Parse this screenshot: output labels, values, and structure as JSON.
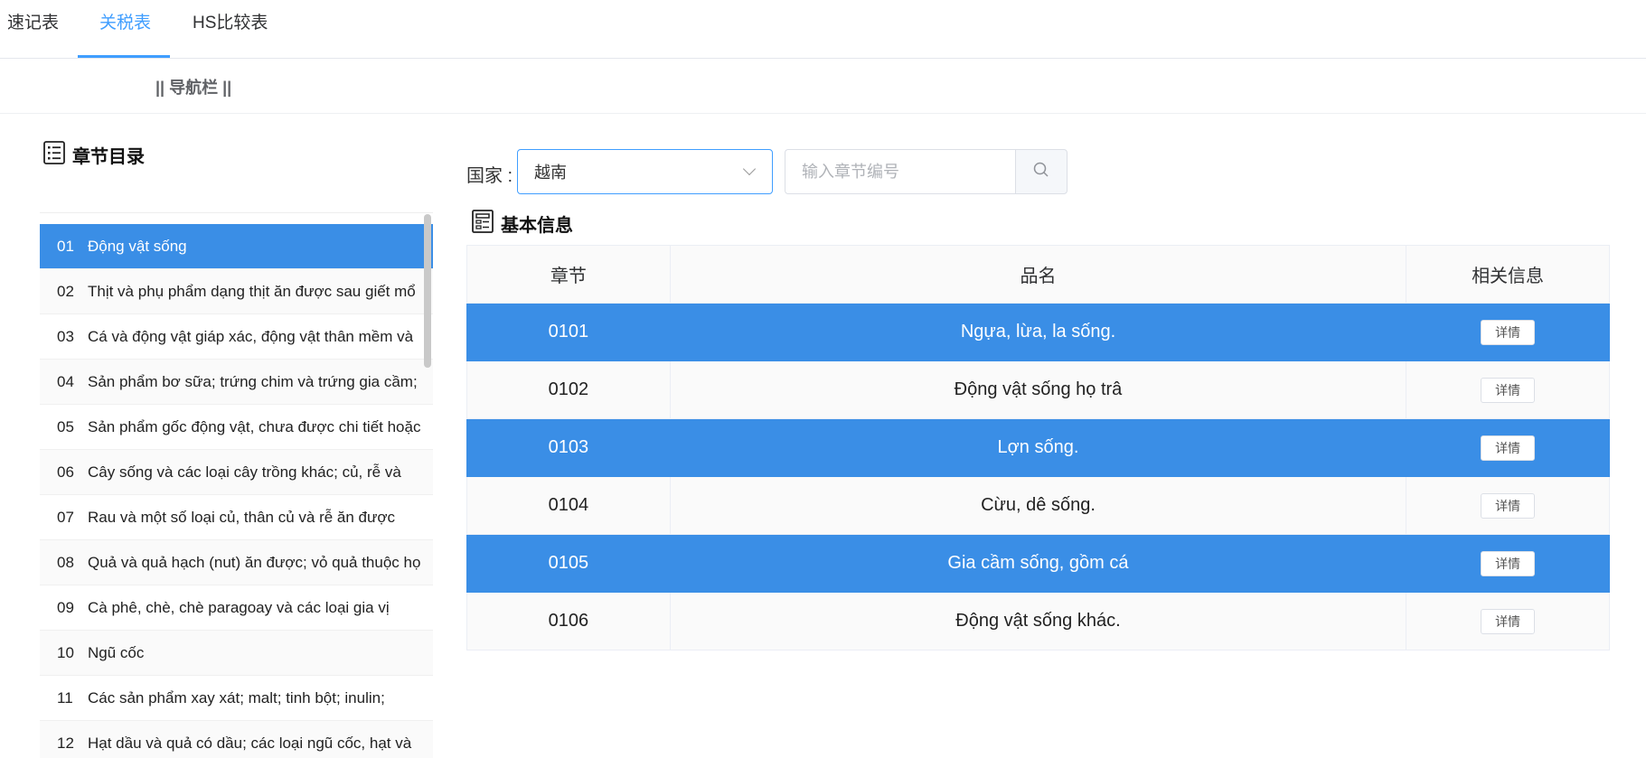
{
  "tabs": [
    {
      "label": "速记表"
    },
    {
      "label": "关税表"
    },
    {
      "label": "HS比较表"
    }
  ],
  "nav": {
    "label": "|| 导航栏 ||"
  },
  "sidebar": {
    "title": "章节目录",
    "items": [
      {
        "num": "01",
        "label": "Động vật sống"
      },
      {
        "num": "02",
        "label": "Thịt và phụ phẩm dạng thịt ăn được sau giết mổ"
      },
      {
        "num": "03",
        "label": "Cá và động vật giáp xác, động vật thân mềm và"
      },
      {
        "num": "04",
        "label": "Sản phẩm bơ sữa; trứng chim và trứng gia cầm;"
      },
      {
        "num": "05",
        "label": "Sản phẩm gốc động vật, chưa được chi tiết hoặc"
      },
      {
        "num": "06",
        "label": "Cây sống và các loại cây trồng khác; củ, rễ và"
      },
      {
        "num": "07",
        "label": "Rau và một số loại củ, thân củ và rễ ăn được"
      },
      {
        "num": "08",
        "label": "Quả và quả hạch (nut) ăn được; vỏ quả thuộc họ"
      },
      {
        "num": "09",
        "label": "Cà phê, chè, chè paragoay và các loại gia vị"
      },
      {
        "num": "10",
        "label": "Ngũ cốc"
      },
      {
        "num": "11",
        "label": "Các sản phẩm xay xát; malt; tinh bột; inulin;"
      },
      {
        "num": "12",
        "label": "Hạt dầu và quả có dầu; các loại ngũ cốc, hạt và"
      }
    ]
  },
  "search": {
    "country_label": "国家 :",
    "country_value": "越南",
    "chapter_placeholder": "输入章节编号"
  },
  "info": {
    "title": "基本信息",
    "headers": {
      "chapter": "章节",
      "name": "品名",
      "related": "相关信息"
    },
    "rows": [
      {
        "chapter": "0101",
        "name": "Ngựa, lừa, la sống.",
        "action": "详情"
      },
      {
        "chapter": "0102",
        "name": "Động vật sống họ trâ",
        "action": "详情"
      },
      {
        "chapter": "0103",
        "name": "Lợn sống.",
        "action": "详情"
      },
      {
        "chapter": "0104",
        "name": "Cừu, dê sống.",
        "action": "详情"
      },
      {
        "chapter": "0105",
        "name": "Gia cầm sống, gồm cá",
        "action": "详情"
      },
      {
        "chapter": "0106",
        "name": "Động vật sống khác.",
        "action": "详情"
      }
    ]
  },
  "colors": {
    "accent": "#409eff",
    "highlight": "#3a8ee6"
  }
}
